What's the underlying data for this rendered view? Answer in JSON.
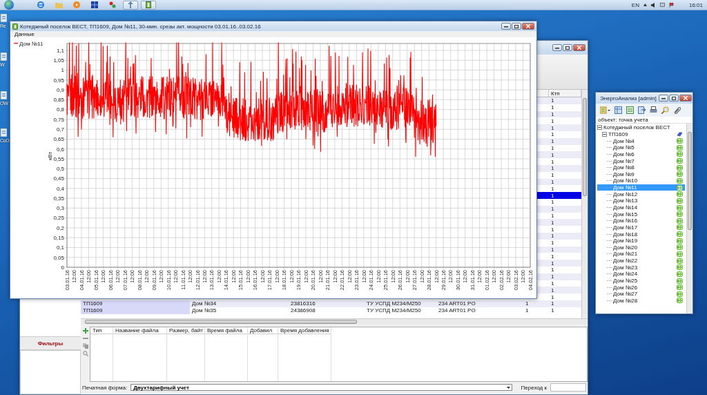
{
  "taskbar": {
    "apps": [
      {
        "kind": "browser",
        "selected": false
      },
      {
        "kind": "folder",
        "selected": false
      },
      {
        "kind": "media",
        "selected": false
      },
      {
        "kind": "grid",
        "selected": false
      },
      {
        "kind": "dots",
        "selected": false
      },
      {
        "kind": "arrows",
        "selected": true
      },
      {
        "kind": "sheet",
        "selected": true
      }
    ],
    "language": "EN",
    "time": "16:01"
  },
  "desktop_icons": [
    {
      "label": "Re"
    },
    {
      "label": "W"
    },
    {
      "label": "OW"
    },
    {
      "label": "CoO"
    }
  ],
  "main_window": {
    "table": {
      "columns": [
        {
          "label": "Ктп"
        }
      ],
      "rows": [
        {
          "kind": "partial",
          "cells": [
            "1"
          ],
          "selected": false
        },
        {
          "kind": "partial",
          "cells": [
            "1"
          ],
          "selected": false
        },
        {
          "kind": "partial",
          "cells": [
            "1"
          ],
          "selected": false
        },
        {
          "kind": "partial",
          "cells": [
            "1"
          ],
          "selected": false
        },
        {
          "kind": "partial",
          "cells": [
            "1"
          ],
          "selected": false
        },
        {
          "kind": "partial",
          "cells": [
            "1"
          ],
          "selected": false
        },
        {
          "kind": "partial",
          "cells": [
            "1"
          ],
          "selected": false
        },
        {
          "kind": "partial",
          "cells": [
            "1"
          ],
          "selected": false
        },
        {
          "kind": "partial",
          "cells": [
            "1"
          ],
          "selected": false
        },
        {
          "kind": "partial",
          "cells": [
            "1"
          ],
          "selected": false
        },
        {
          "kind": "partial",
          "cells": [
            "1"
          ],
          "selected": false
        },
        {
          "kind": "partial",
          "cells": [
            "1"
          ],
          "selected": false
        },
        {
          "kind": "partial",
          "cells": [
            "1"
          ],
          "selected": false
        },
        {
          "kind": "partial",
          "cells": [
            "1"
          ],
          "selected": false
        },
        {
          "kind": "partial",
          "cells": [
            "1"
          ],
          "selected": true
        },
        {
          "kind": "partial",
          "cells": [
            "1"
          ],
          "selected": false
        },
        {
          "kind": "partial",
          "cells": [
            "1"
          ],
          "selected": false
        },
        {
          "kind": "partial",
          "cells": [
            "1"
          ],
          "selected": false
        },
        {
          "kind": "partial",
          "cells": [
            "1"
          ],
          "selected": false
        },
        {
          "kind": "partial",
          "cells": [
            "1"
          ],
          "selected": false
        },
        {
          "kind": "partial",
          "cells": [
            "1"
          ],
          "selected": false
        },
        {
          "kind": "partial",
          "cells": [
            "1"
          ],
          "selected": false
        },
        {
          "kind": "partial",
          "cells": [
            "1"
          ],
          "selected": false
        },
        {
          "kind": "partial",
          "cells": [
            "1"
          ],
          "selected": false
        },
        {
          "kind": "partial",
          "cells": [
            "1"
          ],
          "selected": false
        },
        {
          "kind": "partial",
          "cells": [
            "1"
          ],
          "selected": false
        },
        {
          "kind": "partial",
          "cells": [
            "1"
          ],
          "selected": false
        },
        {
          "kind": "partial",
          "cells": [
            "1"
          ],
          "selected": false
        },
        {
          "kind": "partial",
          "cells": [
            "1"
          ],
          "selected": false
        },
        {
          "kind": "partial",
          "cells": [
            "1"
          ],
          "selected": false
        },
        {
          "kind": "full",
          "cells": [
            "ТП1609",
            "Дом №34",
            "23816316",
            "ТУ УСПД М234/М250",
            "234 ART01 PO",
            "1",
            "1"
          ],
          "selected": false
        },
        {
          "kind": "full",
          "cells": [
            "ТП1609",
            "Дом №35",
            "24386908",
            "ТУ УСПД М234/М250",
            "234 ART01 PO",
            "1",
            "1"
          ],
          "selected": false
        }
      ]
    },
    "files": {
      "columns": [
        "Тип",
        "Название файла",
        "Размер, байт",
        "Время файла",
        "Добавил",
        "Время добавления"
      ]
    },
    "filters": "Фильтры",
    "print_form": {
      "label": "Печатная форма:",
      "value": "Двухтарифный учет"
    },
    "goto": {
      "label": "Переход к"
    }
  },
  "chart_window": {
    "title": "Котеджный поселок ВЕСТ, ТП1609, Дом №11, 30-мин. срезы акт. мощности 03.01.16..03.02.16",
    "menu": [
      "Данные"
    ],
    "chart": {
      "legend": "Дом №11",
      "ylabel": "кВт",
      "yticks": [
        "1,1",
        "1,05",
        "1",
        "0,95",
        "0,9",
        "0,85",
        "0,8",
        "0,75",
        "0,7",
        "0,65",
        "0,6",
        "0,55",
        "0,5",
        "0,45",
        "0,4",
        "0,35",
        "0,3",
        "0,25",
        "0,2",
        "0,15",
        "0,1",
        "0,05",
        "0"
      ],
      "xticks": [
        "03.01.16",
        "12:00",
        "04.01.16",
        "12:00",
        "05.01.16",
        "12:00",
        "06.01.16",
        "12:00",
        "07.01.16",
        "12:00",
        "08.01.16",
        "12:00",
        "09.01.16",
        "12:00",
        "10.01.16",
        "12:00",
        "11.01.16",
        "12:00",
        "12.01.16",
        "12:00",
        "13.01.16",
        "12:00",
        "14.01.16",
        "12:00",
        "15.01.16",
        "12:00",
        "16.01.16",
        "12:00",
        "17.01.16",
        "12:00",
        "18.01.16",
        "12:00",
        "19.01.16",
        "12:00",
        "20.01.16",
        "12:00",
        "21.01.16",
        "12:00",
        "22.01.16",
        "12:00",
        "23.01.16",
        "12:00",
        "24.01.16",
        "12:00",
        "25.01.16",
        "12:00",
        "26.01.16",
        "12:00",
        "27.01.16",
        "12:00",
        "28.01.16",
        "12:00",
        "29.01.16",
        "12:00",
        "30.01.16",
        "12:00",
        "31.01.16",
        "12:00",
        "01.02.16",
        "12:00",
        "02.02.16",
        "12:00",
        "03.02.16",
        "12:00",
        "04.02.16"
      ]
    }
  },
  "right_window": {
    "title": "ЭнергоАнализ [admin]",
    "header": "объект: точка учета",
    "tree": [
      {
        "label": "Котеджный поселок ВЕСТ",
        "expanded": true,
        "selected": false,
        "children": [
          {
            "label": "ТП1609",
            "kind": "substation",
            "expanded": true,
            "selected": false,
            "children": [
              {
                "label": "Дом №4",
                "kind": "meter",
                "selected": false
              },
              {
                "label": "Дом №5",
                "kind": "meter",
                "selected": false
              },
              {
                "label": "Дом №6",
                "kind": "meter",
                "selected": false
              },
              {
                "label": "Дом №7",
                "kind": "meter",
                "selected": false
              },
              {
                "label": "Дом №8",
                "kind": "meter",
                "selected": false
              },
              {
                "label": "Дом №9",
                "kind": "meter",
                "selected": false
              },
              {
                "label": "Дом №10",
                "kind": "meter",
                "selected": false
              },
              {
                "label": "Дом №11",
                "kind": "meter",
                "selected": true
              },
              {
                "label": "Дом №12",
                "kind": "meter",
                "selected": false
              },
              {
                "label": "Дом №13",
                "kind": "meter",
                "selected": false
              },
              {
                "label": "Дом №14",
                "kind": "meter",
                "selected": false
              },
              {
                "label": "Дом №15",
                "kind": "meter",
                "selected": false
              },
              {
                "label": "Дом №16",
                "kind": "meter",
                "selected": false
              },
              {
                "label": "Дом №17",
                "kind": "meter",
                "selected": false
              },
              {
                "label": "Дом №18",
                "kind": "meter",
                "selected": false
              },
              {
                "label": "Дом №19",
                "kind": "meter",
                "selected": false
              },
              {
                "label": "Дом №20",
                "kind": "meter",
                "selected": false
              },
              {
                "label": "Дом №21",
                "kind": "meter",
                "selected": false
              },
              {
                "label": "Дом №22",
                "kind": "meter",
                "selected": false
              },
              {
                "label": "Дом №23",
                "kind": "meter",
                "selected": false
              },
              {
                "label": "Дом №24",
                "kind": "meter",
                "selected": false
              },
              {
                "label": "Дом №25",
                "kind": "meter",
                "selected": false
              },
              {
                "label": "Дом №26",
                "kind": "meter",
                "selected": false
              },
              {
                "label": "Дом №27",
                "kind": "meter",
                "selected": false
              },
              {
                "label": "Дом №28",
                "kind": "meter",
                "selected": false
              }
            ]
          }
        ]
      }
    ]
  }
}
